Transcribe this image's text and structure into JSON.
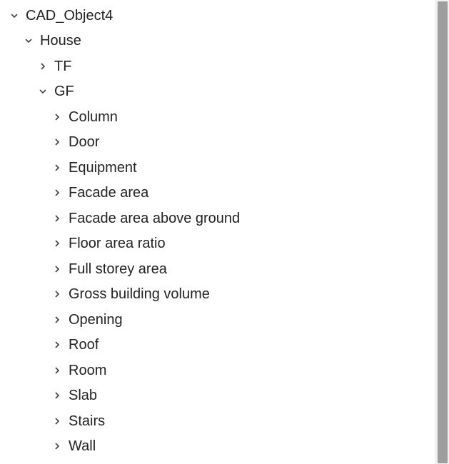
{
  "tree": {
    "root": {
      "label": "CAD_Object4",
      "expanded": true
    },
    "house": {
      "label": "House",
      "expanded": true
    },
    "tf": {
      "label": "TF",
      "expanded": false
    },
    "gf": {
      "label": "GF",
      "expanded": true
    },
    "gf_children": [
      {
        "label": "Column"
      },
      {
        "label": "Door"
      },
      {
        "label": "Equipment"
      },
      {
        "label": "Facade area"
      },
      {
        "label": "Facade area above ground"
      },
      {
        "label": "Floor area ratio"
      },
      {
        "label": "Full storey area"
      },
      {
        "label": "Gross building volume"
      },
      {
        "label": "Opening"
      },
      {
        "label": "Roof"
      },
      {
        "label": "Room"
      },
      {
        "label": "Slab"
      },
      {
        "label": "Stairs"
      },
      {
        "label": "Wall"
      }
    ]
  }
}
